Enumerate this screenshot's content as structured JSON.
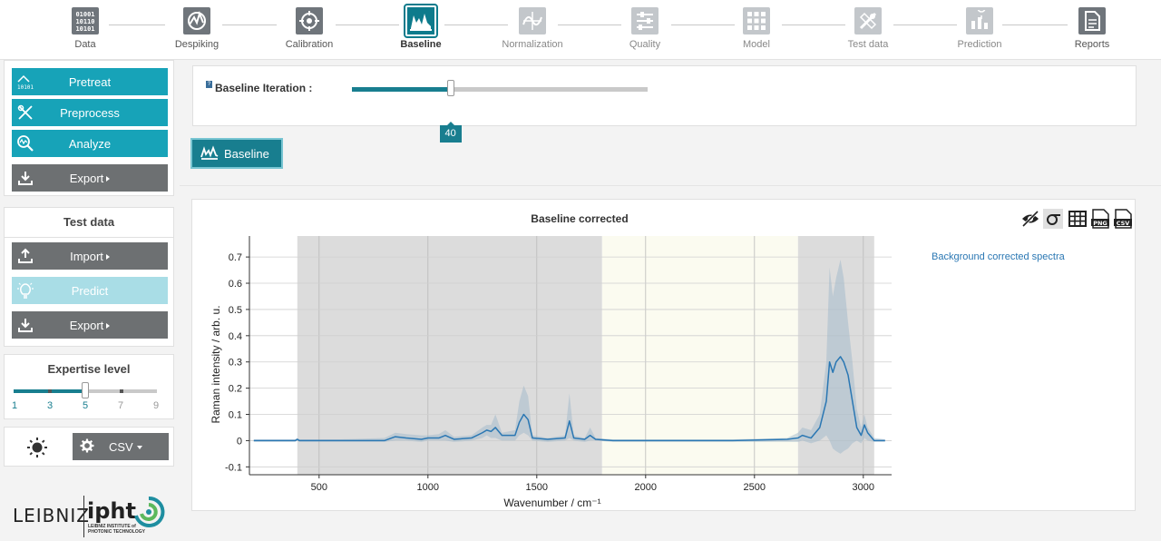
{
  "workflow": {
    "steps": [
      {
        "label": "Data",
        "icon": "binary-data-icon",
        "state": "done"
      },
      {
        "label": "Despiking",
        "icon": "despiking-icon",
        "state": "done"
      },
      {
        "label": "Calibration",
        "icon": "crosshair-target-icon",
        "state": "done"
      },
      {
        "label": "Baseline",
        "icon": "baseline-spectrum-icon",
        "state": "active"
      },
      {
        "label": "Normalization",
        "icon": "normalization-icon",
        "state": "pending"
      },
      {
        "label": "Quality",
        "icon": "sliders-icon",
        "state": "pending"
      },
      {
        "label": "Model",
        "icon": "grid-model-icon",
        "state": "pending"
      },
      {
        "label": "Test data",
        "icon": "test-data-icon",
        "state": "pending"
      },
      {
        "label": "Prediction",
        "icon": "prediction-icon",
        "state": "pending"
      },
      {
        "label": "Reports",
        "icon": "report-document-icon",
        "state": "done"
      }
    ]
  },
  "sidebar": {
    "pretreat": "Pretreat",
    "preprocess": "Preprocess",
    "analyze": "Analyze",
    "export": "Export",
    "test_data_title": "Test data",
    "import": "Import",
    "predict": "Predict",
    "export2": "Export",
    "expertise_title": "Expertise level",
    "expertise": {
      "levels": [
        "1",
        "3",
        "5",
        "7",
        "9"
      ],
      "value": 5,
      "min": 1,
      "max": 9
    },
    "format": "CSV"
  },
  "logo": {
    "leibniz": "LEIBNIZ",
    "ipht": "ipht",
    "sub": "LEIBNIZ INSTITUTE of PHOTONIC TECHNOLOGY"
  },
  "main": {
    "help": "?",
    "iteration_label": "Baseline Iteration :",
    "iteration": {
      "value": 40,
      "min": 0,
      "max": 120
    },
    "baseline_button": "Baseline"
  },
  "colors": {
    "accent": "#187e8f",
    "teal": "#17a3b8",
    "line": "#2a77b3",
    "band": "#9ab4c8"
  },
  "chart_data": {
    "type": "line",
    "title": "Baseline corrected",
    "xlabel": "Wavenumber / cm⁻¹",
    "ylabel": "Raman intensity / arb. u.",
    "xlim": [
      180,
      3130
    ],
    "ylim": [
      -0.13,
      0.78
    ],
    "xticks": [
      500,
      1000,
      1500,
      2000,
      2500,
      3000
    ],
    "yticks": [
      -0.1,
      0,
      0.1,
      0.2,
      0.3,
      0.4,
      0.5,
      0.6,
      0.7
    ],
    "ytick_labels": [
      "-0.1",
      "0",
      "0.1",
      "0.2",
      "0.3",
      "0.4",
      "0.5",
      "0.6",
      "0.7"
    ],
    "grid": true,
    "legend_placement": "right",
    "regions": [
      {
        "from": 400,
        "to": 1800,
        "shade": "gray"
      },
      {
        "from": 1800,
        "to": 2700,
        "shade": "light-yellow"
      },
      {
        "from": 2700,
        "to": 3050,
        "shade": "gray"
      }
    ],
    "series": [
      {
        "name": "Background corrected spectra",
        "x": [
          200,
          390,
          400,
          410,
          600,
          800,
          850,
          900,
          970,
          1000,
          1050,
          1080,
          1120,
          1200,
          1250,
          1270,
          1290,
          1310,
          1340,
          1400,
          1420,
          1440,
          1460,
          1480,
          1550,
          1630,
          1650,
          1670,
          1720,
          1745,
          1770,
          1850,
          2400,
          2650,
          2700,
          2720,
          2760,
          2800,
          2830,
          2845,
          2860,
          2875,
          2895,
          2910,
          2930,
          2950,
          2970,
          2990,
          3005,
          3020,
          3050,
          3100
        ],
        "y": [
          0,
          0,
          0.005,
          0,
          0,
          0,
          0.015,
          0.01,
          0.005,
          0.01,
          0.01,
          0.02,
          0.005,
          0.01,
          0.03,
          0.04,
          0.035,
          0.05,
          0.02,
          0.02,
          0.07,
          0.1,
          0.08,
          0.01,
          0.005,
          0.01,
          0.075,
          0.01,
          0.005,
          0.02,
          0.005,
          0,
          0,
          0.005,
          0.01,
          0.02,
          0.01,
          0.05,
          0.15,
          0.3,
          0.26,
          0.3,
          0.32,
          0.3,
          0.25,
          0.15,
          0.05,
          0.02,
          0.06,
          0.03,
          0,
          0
        ],
        "band_upper": [
          0.005,
          0.005,
          0.01,
          0.005,
          0.005,
          0.01,
          0.03,
          0.025,
          0.02,
          0.02,
          0.025,
          0.04,
          0.015,
          0.02,
          0.05,
          0.06,
          0.06,
          0.1,
          0.03,
          0.04,
          0.15,
          0.21,
          0.17,
          0.02,
          0.01,
          0.02,
          0.18,
          0.02,
          0.01,
          0.05,
          0.01,
          0.005,
          0.005,
          0.01,
          0.03,
          0.05,
          0.04,
          0.1,
          0.3,
          0.66,
          0.55,
          0.62,
          0.69,
          0.62,
          0.45,
          0.3,
          0.12,
          0.05,
          0.1,
          0.05,
          0.01,
          0.005
        ],
        "band_lower": [
          -0.005,
          -0.005,
          0,
          -0.005,
          -0.005,
          -0.005,
          0,
          0,
          -0.005,
          0,
          0,
          0,
          -0.005,
          0,
          0.01,
          0.02,
          0.01,
          0.01,
          0,
          0,
          0.02,
          0.03,
          0.02,
          0,
          -0.005,
          0,
          0.01,
          0,
          -0.005,
          0,
          0,
          -0.005,
          -0.005,
          -0.005,
          -0.005,
          0,
          -0.01,
          0,
          0.02,
          0,
          -0.03,
          -0.04,
          -0.05,
          -0.04,
          -0.03,
          -0.01,
          0,
          -0.01,
          0.01,
          0,
          -0.005,
          -0.005
        ]
      }
    ]
  }
}
